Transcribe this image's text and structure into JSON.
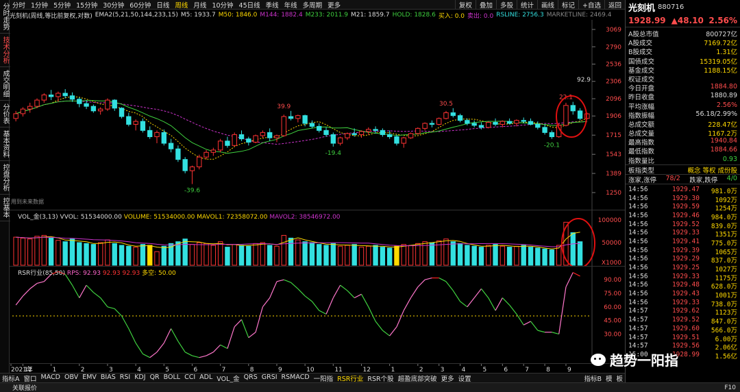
{
  "left_tabs": [
    "分时走势",
    "技术分析",
    "成交明细",
    "分价表",
    "基本资料",
    "控盘分析",
    "控基本"
  ],
  "timeframes": [
    "分时",
    "1分钟",
    "5分钟",
    "15分钟",
    "30分钟",
    "60分钟",
    "日线",
    "周线",
    "月线",
    "10分钟",
    "45日线",
    "季线",
    "年线",
    "多周期",
    "更多"
  ],
  "active_timeframe": "周线",
  "toolbar_right": [
    "复权",
    "叠加",
    "统计",
    "画线",
    "标记",
    "+自选",
    "返回"
  ],
  "toolbar_right_extra": [
    "多股"
  ],
  "info": {
    "name": "光刻机(周线,等比前复权,对数)",
    "ema": "EMA2(5,21,50,144,233,15)",
    "m5": "M5: 1933.7",
    "m50": "M50: 1846.0",
    "m144": "M144: 1882.4",
    "m233": "M233: 2011.9",
    "m21": "M21: 1859.7",
    "hold": "HOLD: 1828.6",
    "buy": "买入: 0.0",
    "sell": "卖出: 0.0",
    "rsline": "RSLINE: 2756.3",
    "marketline": "MARKETLINE: 2469.4"
  },
  "price_axis": [
    "3069",
    "2790",
    "2536",
    "2306",
    "2096",
    "1906",
    "1715",
    "1543",
    "1389",
    "1250"
  ],
  "annotations": {
    "high_right": "92.9",
    "a1": "39.9",
    "a2": "30.5",
    "a3": "22.1",
    "low1": "-39.6",
    "low2": "-19.4",
    "low3": "-20.1",
    "nodata": "用到未来数据"
  },
  "vol": {
    "title": "VOL_金(3,13)",
    "vvol": "VVOL: 51534000.00",
    "volume": "VOLUME: 51534000.00",
    "mavol1": "MAVOL1: 72358072.00",
    "mavol2": "MAVOL2: 38546972.00",
    "axis": [
      "100000",
      "50000",
      "X1000"
    ]
  },
  "rsr": {
    "title": "RSR行业(85,50)",
    "rps": "RPS: 92.93",
    "v2": "92.93",
    "v3": "92.93",
    "duokong": "多空: 50.00",
    "axis": [
      "90.00",
      "75.00",
      "60.00",
      "45.00",
      "30.00"
    ]
  },
  "time_axis": [
    "2021年",
    "12",
    "1",
    "2",
    "3",
    "4",
    "5",
    "6",
    "7",
    "8",
    "9",
    "10",
    "11",
    "12",
    "1",
    "2",
    "3",
    "4",
    "5",
    "6",
    "7",
    "8",
    "9"
  ],
  "bottom_tabs": [
    "指标A",
    "窗口",
    "MACD",
    "OBV",
    "EMV",
    "BIAS",
    "RSI",
    "KDJ",
    "QR",
    "BOLL",
    "CCI",
    "ADL",
    "VOL_金",
    "QRS",
    "GRSI",
    "RSMACD",
    "一阳指",
    "RSR行业",
    "RSR个股",
    "超盈底部突破",
    "更多",
    "设置"
  ],
  "active_bottom_tab": "RSR行业",
  "bottom_right": [
    "指标B",
    "模",
    "板"
  ],
  "status": {
    "left": "关联报价",
    "right": "F10"
  },
  "stock": {
    "name": "光刻机",
    "code": "880716",
    "price": "1928.99",
    "change": "▲48.10",
    "pct": "2.56%"
  },
  "stats": [
    {
      "label": "A股总市值",
      "value": "800727亿",
      "color": "#dddddd"
    },
    {
      "label": "A股成交",
      "value": "7169.72亿",
      "color": "#ffd900"
    },
    {
      "label": "B股成交",
      "value": "1.31亿",
      "color": "#ffd900"
    },
    {
      "label": "国债成交",
      "value": "15319.05亿",
      "color": "#ffd900"
    },
    {
      "label": "基金成交",
      "value": "1188.15亿",
      "color": "#ffd900"
    },
    {
      "label": "权证成交",
      "value": "",
      "color": "#ffd900"
    },
    {
      "label": "今日开盘",
      "value": "1884.80",
      "color": "#ff4d4d"
    },
    {
      "label": "昨日收盘",
      "value": "1880.89",
      "color": "#dddddd"
    },
    {
      "label": "平均涨幅",
      "value": "2.56%",
      "color": "#ff4d4d"
    },
    {
      "label": "指数振幅",
      "value": "56.18/2.99%",
      "color": "#dddddd"
    },
    {
      "label": "总成交额",
      "value": "228.47亿",
      "color": "#ffd900"
    },
    {
      "label": "总成交量",
      "value": "1167.2万",
      "color": "#ffd900"
    },
    {
      "label": "最高指数",
      "value": "1940.84",
      "color": "#ff4d4d"
    },
    {
      "label": "最低指数",
      "value": "1884.66",
      "color": "#ff4d4d"
    },
    {
      "label": "指数量比",
      "value": "0.93",
      "color": "#3fd13f"
    }
  ],
  "board": {
    "label": "板指类型",
    "value": "概念 等权 成份股"
  },
  "updown": {
    "l1": "涨家,涨停",
    "v1": "78/2",
    "l2": "跌家,跌停",
    "v2": "4/0"
  },
  "ticks": [
    [
      "14:56",
      "1929.47",
      "981.0万"
    ],
    [
      "14:56",
      "1929.30",
      "1092万"
    ],
    [
      "14:56",
      "1929.59",
      "1254万"
    ],
    [
      "14:56",
      "1929.46",
      "984.0万"
    ],
    [
      "14:56",
      "1929.52",
      "839.0万"
    ],
    [
      "14:56",
      "1929.33",
      "1351万"
    ],
    [
      "14:56",
      "1929.41",
      "775.0万"
    ],
    [
      "14:56",
      "1929.39",
      "1065万"
    ],
    [
      "14:56",
      "1929.29",
      "837.0万"
    ],
    [
      "14:56",
      "1929.25",
      "1027万"
    ],
    [
      "14:56",
      "1929.33",
      "1175万"
    ],
    [
      "14:56",
      "1929.48",
      "628.0万"
    ],
    [
      "14:56",
      "1929.43",
      "1001万"
    ],
    [
      "14:56",
      "1929.33",
      "738.0万"
    ],
    [
      "14:57",
      "1929.62",
      "1123万"
    ],
    [
      "14:57",
      "1929.52",
      "847.0万"
    ],
    [
      "14:57",
      "1929.60",
      "566.0万"
    ],
    [
      "14:57",
      "1929.51",
      "6.00万"
    ],
    [
      "14:57",
      "1929.56",
      "2.06亿"
    ],
    [
      "15:00",
      "1928.99",
      "1.56亿"
    ]
  ],
  "watermark": "趋势一阳指",
  "colors": {
    "up": "#ff3333",
    "down": "#33e0e0",
    "accent": "#ffd900",
    "circle": "#e01010",
    "ma5": "#ffd900",
    "ma21": "#3fd13f",
    "ma50": "#cc33cc"
  },
  "chart_data": {
    "type": "candlestick",
    "candles": [
      [
        1880,
        1960,
        1850,
        1930
      ],
      [
        1930,
        2000,
        1900,
        1980
      ],
      [
        1980,
        2050,
        1940,
        2010
      ],
      [
        2010,
        2100,
        1990,
        2080
      ],
      [
        2080,
        2160,
        2050,
        2140
      ],
      [
        2140,
        2200,
        2080,
        2120
      ],
      [
        2120,
        2180,
        2060,
        2160
      ],
      [
        2160,
        2210,
        2100,
        2130
      ],
      [
        2130,
        2170,
        2060,
        2090
      ],
      [
        2090,
        2110,
        2000,
        2040
      ],
      [
        2040,
        2080,
        1980,
        2010
      ],
      [
        2010,
        2030,
        1940,
        1960
      ],
      [
        1960,
        2000,
        1920,
        1980
      ],
      [
        1980,
        2100,
        1960,
        2080
      ],
      [
        2080,
        2090,
        1960,
        1990
      ],
      [
        1990,
        2000,
        1880,
        1900
      ],
      [
        1900,
        1940,
        1800,
        1820
      ],
      [
        1820,
        1870,
        1760,
        1850
      ],
      [
        1850,
        1880,
        1740,
        1760
      ],
      [
        1760,
        1800,
        1680,
        1700
      ],
      [
        1700,
        1760,
        1640,
        1740
      ],
      [
        1740,
        1770,
        1620,
        1640
      ],
      [
        1640,
        1680,
        1560,
        1590
      ],
      [
        1590,
        1620,
        1480,
        1500
      ],
      [
        1500,
        1520,
        1390,
        1410
      ],
      [
        1410,
        1450,
        1310,
        1440
      ],
      [
        1440,
        1540,
        1420,
        1520
      ],
      [
        1520,
        1580,
        1500,
        1560
      ],
      [
        1560,
        1600,
        1530,
        1580
      ],
      [
        1580,
        1680,
        1560,
        1660
      ],
      [
        1660,
        1700,
        1600,
        1620
      ],
      [
        1620,
        1740,
        1610,
        1720
      ],
      [
        1720,
        1760,
        1660,
        1680
      ],
      [
        1680,
        1700,
        1620,
        1650
      ],
      [
        1650,
        1720,
        1640,
        1710
      ],
      [
        1710,
        1760,
        1690,
        1740
      ],
      [
        1740,
        1780,
        1660,
        1690
      ],
      [
        1690,
        1720,
        1650,
        1710
      ],
      [
        1710,
        1920,
        1700,
        1900
      ],
      [
        1900,
        1960,
        1860,
        1880
      ],
      [
        1880,
        1920,
        1840,
        1910
      ],
      [
        1910,
        1920,
        1800,
        1830
      ],
      [
        1830,
        1860,
        1780,
        1800
      ],
      [
        1800,
        1830,
        1740,
        1760
      ],
      [
        1760,
        1790,
        1700,
        1720
      ],
      [
        1720,
        1740,
        1610,
        1640
      ],
      [
        1640,
        1700,
        1620,
        1690
      ],
      [
        1690,
        1740,
        1670,
        1730
      ],
      [
        1730,
        1780,
        1700,
        1720
      ],
      [
        1720,
        1760,
        1690,
        1750
      ],
      [
        1750,
        1790,
        1720,
        1770
      ],
      [
        1770,
        1800,
        1730,
        1760
      ],
      [
        1760,
        1780,
        1700,
        1720
      ],
      [
        1720,
        1760,
        1680,
        1700
      ],
      [
        1700,
        1720,
        1620,
        1640
      ],
      [
        1640,
        1700,
        1600,
        1690
      ],
      [
        1690,
        1740,
        1680,
        1730
      ],
      [
        1730,
        1790,
        1720,
        1780
      ],
      [
        1780,
        1840,
        1760,
        1830
      ],
      [
        1830,
        1860,
        1790,
        1820
      ],
      [
        1820,
        1890,
        1810,
        1880
      ],
      [
        1880,
        1960,
        1870,
        1940
      ],
      [
        1940,
        1990,
        1890,
        1910
      ],
      [
        1910,
        1930,
        1840,
        1860
      ],
      [
        1860,
        1880,
        1810,
        1830
      ],
      [
        1830,
        1860,
        1790,
        1810
      ],
      [
        1810,
        1840,
        1770,
        1790
      ],
      [
        1790,
        1850,
        1780,
        1840
      ],
      [
        1840,
        1880,
        1800,
        1820
      ],
      [
        1820,
        1860,
        1790,
        1850
      ],
      [
        1850,
        1880,
        1820,
        1830
      ],
      [
        1830,
        1870,
        1800,
        1860
      ],
      [
        1860,
        1890,
        1830,
        1850
      ],
      [
        1850,
        1880,
        1810,
        1820
      ],
      [
        1820,
        1850,
        1770,
        1790
      ],
      [
        1790,
        1820,
        1720,
        1740
      ],
      [
        1740,
        1760,
        1680,
        1700
      ],
      [
        1700,
        1830,
        1690,
        1810
      ],
      [
        1810,
        2050,
        1800,
        2020
      ],
      [
        2020,
        2060,
        1920,
        1960
      ],
      [
        1960,
        1990,
        1860,
        1880
      ],
      [
        1880,
        1940,
        1870,
        1929
      ]
    ],
    "volume": [
      62,
      60,
      58,
      64,
      66,
      60,
      55,
      52,
      58,
      50,
      48,
      46,
      50,
      56,
      48,
      44,
      42,
      40,
      46,
      44,
      30,
      42,
      48,
      52,
      58,
      46,
      50,
      48,
      44,
      52,
      40,
      46,
      44,
      42,
      48,
      50,
      44,
      42,
      66,
      60,
      56,
      52,
      50,
      46,
      44,
      48,
      42,
      44,
      46,
      40,
      42,
      44,
      40,
      38,
      42,
      46,
      44,
      48,
      52,
      50,
      54,
      58,
      52,
      48,
      44,
      42,
      40,
      44,
      46,
      42,
      40,
      42,
      44,
      40,
      38,
      36,
      34,
      44,
      95,
      72,
      52
    ],
    "rsr": [
      62,
      72,
      80,
      86,
      88,
      96,
      99,
      96,
      84,
      70,
      84,
      76,
      70,
      60,
      58,
      50,
      36,
      20,
      8,
      4,
      10,
      20,
      36,
      22,
      10,
      6,
      4,
      6,
      10,
      18,
      14,
      38,
      46,
      26,
      32,
      60,
      70,
      88,
      90,
      87,
      80,
      72,
      66,
      56,
      52,
      70,
      84,
      78,
      70,
      74,
      60,
      44,
      34,
      28,
      38,
      56,
      70,
      82,
      90,
      92,
      92,
      88,
      78,
      66,
      60,
      70,
      80,
      70,
      56,
      70,
      62,
      52,
      40,
      44,
      34,
      32,
      32,
      30,
      82,
      98,
      94
    ],
    "ylim": [
      1250,
      3069
    ],
    "ylog": true
  }
}
